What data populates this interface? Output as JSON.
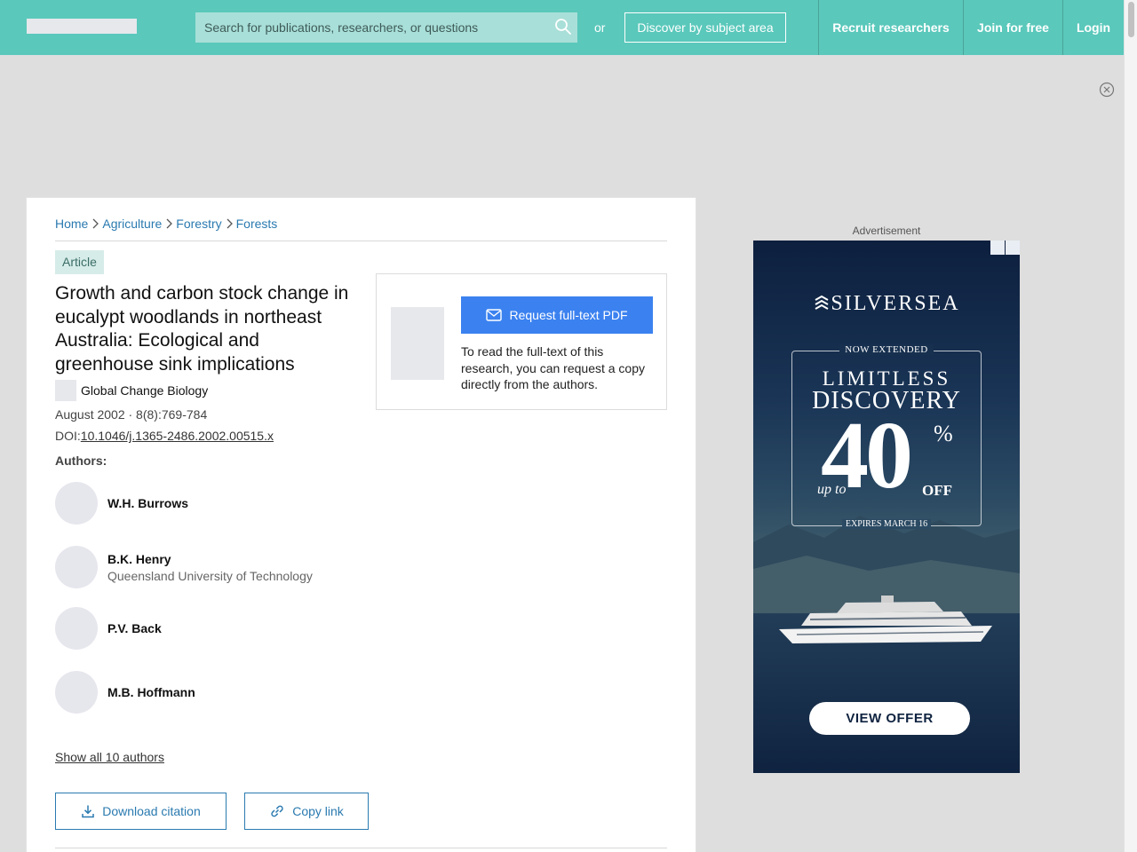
{
  "header": {
    "search_placeholder": "Search for publications, researchers, or questions",
    "or_text": "or",
    "discover_label": "Discover by subject area",
    "nav": {
      "recruit": "Recruit researchers",
      "join": "Join for free",
      "login": "Login"
    }
  },
  "breadcrumb": [
    "Home",
    "Agriculture",
    "Forestry",
    "Forests"
  ],
  "article": {
    "type_badge": "Article",
    "title": "Growth and carbon stock change in eucalypt woodlands in northeast Australia: Ecological and greenhouse sink implications",
    "journal": "Global Change Biology",
    "date_volume": "August 2002 · 8(8):769-784",
    "doi_label": "DOI:",
    "doi": "10.1046/j.1365-2486.2002.00515.x",
    "authors_label": "Authors:",
    "authors": [
      {
        "name": "W.H. Burrows",
        "affiliation": ""
      },
      {
        "name": "B.K. Henry",
        "affiliation": "Queensland University of Technology"
      },
      {
        "name": "P.V. Back",
        "affiliation": ""
      },
      {
        "name": "M.B. Hoffmann",
        "affiliation": ""
      }
    ],
    "show_all_label": "Show all 10 authors",
    "download_citation_label": "Download citation",
    "copy_link_label": "Copy link"
  },
  "request": {
    "button_label": "Request full-text PDF",
    "text": "To read the full-text of this research, you can request a copy directly from the authors."
  },
  "ad": {
    "label": "Advertisement",
    "brand": "SILVERSEA",
    "now_extended": "NOW EXTENDED",
    "headline_1": "LIMITLESS",
    "headline_2": "DISCOVERY",
    "up_to": "up to",
    "discount": "40",
    "percent": "%",
    "off": "OFF",
    "expires": "EXPIRES MARCH 16",
    "cta": "VIEW OFFER"
  },
  "colors": {
    "header_bg": "#5ac8bb",
    "link": "#2a7ab0",
    "primary_button": "#3b82f0",
    "badge_bg": "#d6ece9"
  },
  "icons": {
    "search": "search-icon",
    "close_ad": "close-circle-icon",
    "breadcrumb_separator": "chevron-right-icon",
    "request": "envelope-icon",
    "download": "download-icon",
    "copy_link": "link-icon"
  }
}
